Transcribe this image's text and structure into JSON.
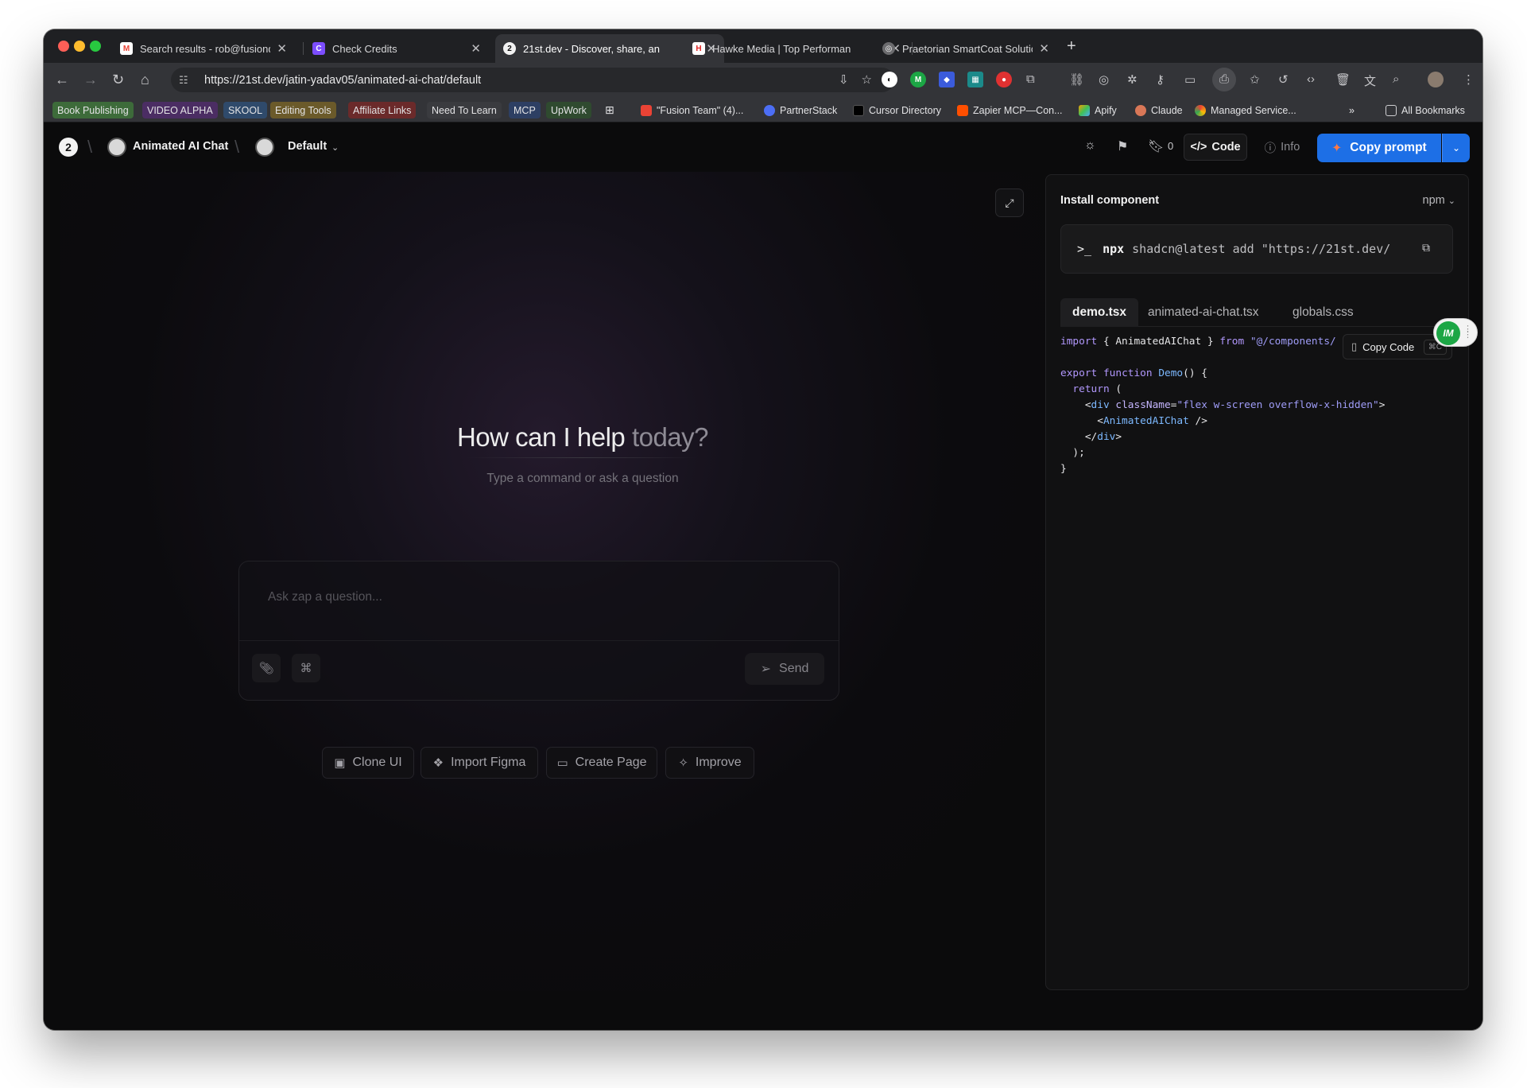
{
  "browser": {
    "tabs": [
      {
        "title": "Search results - rob@fusiond",
        "icon_color": "#ea4335",
        "icon": "gmail-icon"
      },
      {
        "title": "Check Credits",
        "icon_color": "#7c4dff",
        "icon": "credits-icon"
      },
      {
        "title": "21st.dev - Discover, share, an",
        "icon_color": "#f2f2f2",
        "icon": "21st-icon"
      },
      {
        "title": "Hawke Media | Top Performan",
        "icon_color": "#e02424",
        "icon": "hawke-icon"
      },
      {
        "title": "Praetorian SmartCoat Solutio",
        "icon_color": "#9b9b9b",
        "icon": "globe-icon"
      }
    ],
    "active_tab": 2,
    "url": "https://21st.dev/jatin-yadav05/animated-ai-chat/default",
    "bookmarks": [
      {
        "label": "Book Publishing",
        "color": "#3d6b3a"
      },
      {
        "label": "VIDEO ALPHA",
        "color": "#4b2d63"
      },
      {
        "label": "SKOOL",
        "color": "#2f4a6b"
      },
      {
        "label": "Editing Tools",
        "color": "#6b5a2a"
      },
      {
        "label": "Affiliate Links",
        "color": "#6b2a2a"
      },
      {
        "label": "Need To Learn",
        "color": "#3a3b3f"
      },
      {
        "label": "MCP",
        "color": "#2d3f63"
      },
      {
        "label": "UpWork",
        "color": "#2f4a2f"
      },
      {
        "label": "\"Fusion Team\" (4)...",
        "color": ""
      },
      {
        "label": "PartnerStack",
        "color": ""
      },
      {
        "label": "Cursor Directory",
        "color": ""
      },
      {
        "label": "Zapier MCP—Con...",
        "color": ""
      },
      {
        "label": "Apify",
        "color": ""
      },
      {
        "label": "Claude",
        "color": ""
      },
      {
        "label": "Managed Service...",
        "color": ""
      },
      {
        "label": "All Bookmarks",
        "color": ""
      }
    ]
  },
  "header": {
    "project": "Animated AI Chat",
    "variant": "Default",
    "bookmark_count": "0",
    "code_label": "Code",
    "info_label": "Info",
    "copy_prompt": "Copy prompt"
  },
  "preview": {
    "heading_a": "How can I help ",
    "heading_b": "today?",
    "subheading": "Type a command or ask a question",
    "placeholder": "Ask zap a question...",
    "send": "Send",
    "actions": [
      "Clone UI",
      "Import Figma",
      "Create Page",
      "Improve"
    ]
  },
  "panel": {
    "title": "Install component",
    "package_manager": "npm",
    "command_prefix": "npx",
    "command": "shadcn@latest add \"https://21st.dev/",
    "files": [
      "demo.tsx",
      "animated-ai-chat.tsx",
      "globals.css"
    ],
    "active_file": 0,
    "copy_code": "Copy Code",
    "copy_shortcut": "⌘C",
    "badge": "IM"
  },
  "colors": {
    "accent": "#1d6fe6",
    "background": "#0b0b0c"
  }
}
